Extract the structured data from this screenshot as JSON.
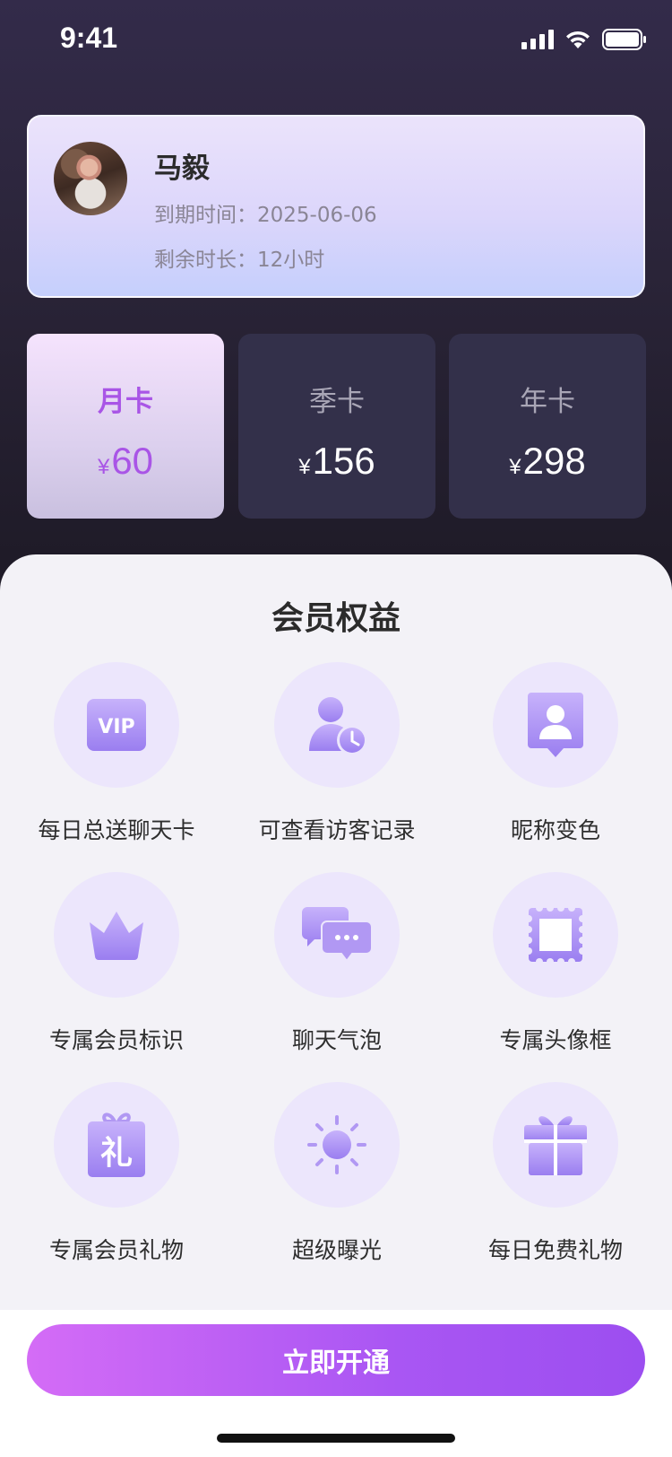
{
  "status_bar": {
    "time": "9:41"
  },
  "profile": {
    "name": "马毅",
    "expire_label": "到期时间：",
    "expire_value": "2025-06-06",
    "remain_label": "剩余时长：",
    "remain_value": "12小时"
  },
  "plans": [
    {
      "name": "月卡",
      "currency": "¥",
      "price": "60",
      "selected": true
    },
    {
      "name": "季卡",
      "currency": "¥",
      "price": "156",
      "selected": false
    },
    {
      "name": "年卡",
      "currency": "¥",
      "price": "298",
      "selected": false
    }
  ],
  "benefits": {
    "title": "会员权益",
    "items": [
      {
        "label": "每日总送聊天卡",
        "icon": "vip-card-icon"
      },
      {
        "label": "可查看访客记录",
        "icon": "visitor-clock-icon"
      },
      {
        "label": "昵称变色",
        "icon": "nickname-badge-icon"
      },
      {
        "label": "专属会员标识",
        "icon": "crown-icon"
      },
      {
        "label": "聊天气泡",
        "icon": "chat-bubble-icon"
      },
      {
        "label": "专属头像框",
        "icon": "avatar-frame-icon"
      },
      {
        "label": "专属会员礼物",
        "icon": "gift-box-icon"
      },
      {
        "label": "超级曝光",
        "icon": "sun-icon"
      },
      {
        "label": "每日免费礼物",
        "icon": "present-icon"
      }
    ]
  },
  "cta": {
    "label": "立即开通"
  },
  "colors": {
    "accent": "#a955e6",
    "icon_fill": "#a98af0",
    "icon_bg": "#ece6fc",
    "cta_gradient_start": "#d46cf6",
    "cta_gradient_end": "#9c4ef0"
  }
}
